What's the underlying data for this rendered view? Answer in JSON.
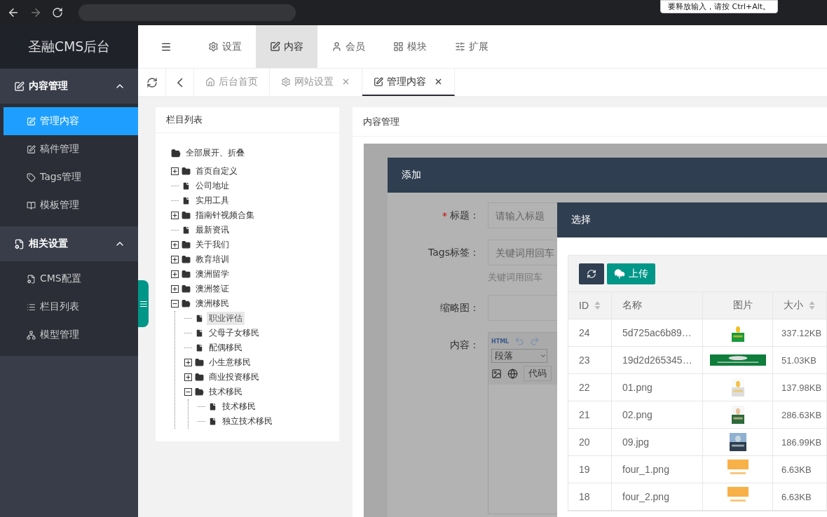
{
  "browser": {
    "tooltip": "要释放输入，请按 Ctrl+Alt。"
  },
  "brand": "圣融CMS后台",
  "sidebar": {
    "groups": [
      {
        "title": "内容管理",
        "expanded": true,
        "items": [
          {
            "label": "管理内容",
            "selected": true
          },
          {
            "label": "稿件管理",
            "selected": false
          },
          {
            "label": "Tags管理",
            "selected": false
          },
          {
            "label": "模板管理",
            "selected": false
          }
        ]
      },
      {
        "title": "相关设置",
        "expanded": true,
        "items": [
          {
            "label": "CMS配置",
            "selected": false
          },
          {
            "label": "栏目列表",
            "selected": false
          },
          {
            "label": "模型管理",
            "selected": false
          }
        ]
      }
    ]
  },
  "top_nav": [
    {
      "label": "设置",
      "selected": false
    },
    {
      "label": "内容",
      "selected": true
    },
    {
      "label": "会员",
      "selected": false
    },
    {
      "label": "模块",
      "selected": false
    },
    {
      "label": "扩展",
      "selected": false
    }
  ],
  "tabs": [
    {
      "label": "后台首页",
      "selected": false,
      "closable": false
    },
    {
      "label": "网站设置",
      "selected": false,
      "closable": true
    },
    {
      "label": "管理内容",
      "selected": true,
      "closable": true
    }
  ],
  "left_panel": {
    "title": "栏目列表",
    "root": "全部展开、折叠",
    "tree": [
      {
        "label": "首页自定义",
        "kind": "folder",
        "expanded": false,
        "selected": false
      },
      {
        "label": "公司地址",
        "kind": "file",
        "selected": false
      },
      {
        "label": "实用工具",
        "kind": "file",
        "selected": false
      },
      {
        "label": "指南针视频合集",
        "kind": "folder",
        "expanded": false,
        "selected": false
      },
      {
        "label": "最新资讯",
        "kind": "file",
        "selected": false
      },
      {
        "label": "关于我们",
        "kind": "folder",
        "expanded": false,
        "selected": false
      },
      {
        "label": "教育培训",
        "kind": "folder",
        "expanded": false,
        "selected": false
      },
      {
        "label": "澳洲留学",
        "kind": "folder",
        "expanded": false,
        "selected": false
      },
      {
        "label": "澳洲签证",
        "kind": "folder",
        "expanded": false,
        "selected": false
      },
      {
        "label": "澳洲移民",
        "kind": "folder",
        "expanded": true,
        "selected": false,
        "children": [
          {
            "label": "职业评估",
            "kind": "file",
            "selected": true
          },
          {
            "label": "父母子女移民",
            "kind": "file",
            "selected": false
          },
          {
            "label": "配偶移民",
            "kind": "file",
            "selected": false
          },
          {
            "label": "小生意移民",
            "kind": "folder",
            "expanded": false,
            "selected": false
          },
          {
            "label": "商业投资移民",
            "kind": "folder",
            "expanded": false,
            "selected": false
          },
          {
            "label": "技术移民",
            "kind": "folder",
            "expanded": true,
            "selected": false,
            "children": [
              {
                "label": "技术移民",
                "kind": "file",
                "selected": false
              },
              {
                "label": "独立技术移民",
                "kind": "file",
                "selected": false
              }
            ]
          }
        ]
      }
    ]
  },
  "content_panel": {
    "title": "内容管理"
  },
  "add_dialog": {
    "title": "添加",
    "fields": [
      {
        "label": "标题：",
        "required_mark": "*",
        "placeholder": "请输入标题"
      },
      {
        "label": "Tags标签：",
        "placeholder": "关键词用回车",
        "hint": "关键词用回车"
      },
      {
        "label": "缩略图："
      },
      {
        "label": "内容：",
        "kind": "editor"
      }
    ],
    "editor": {
      "source": "HTML",
      "format": "段落",
      "code": "代码"
    }
  },
  "select_dialog": {
    "title": "选择",
    "upload": "上传",
    "columns": [
      {
        "label": "ID",
        "sortable": true
      },
      {
        "label": "名称",
        "sortable": false
      },
      {
        "label": "图片",
        "sortable": false
      },
      {
        "label": "大小",
        "sortable": true
      }
    ],
    "rows": [
      {
        "id": "24",
        "name": "5d725ac6b89…",
        "size": "337.12KB"
      },
      {
        "id": "23",
        "name": "19d2d265345…",
        "size": "51.03KB"
      },
      {
        "id": "22",
        "name": "01.png",
        "size": "137.98KB"
      },
      {
        "id": "21",
        "name": "02.png",
        "size": "286.63KB"
      },
      {
        "id": "20",
        "name": "09.jpg",
        "size": "186.99KB"
      },
      {
        "id": "19",
        "name": "four_1.png",
        "size": "6.63KB"
      },
      {
        "id": "18",
        "name": "four_2.png",
        "size": "6.63KB"
      }
    ]
  }
}
